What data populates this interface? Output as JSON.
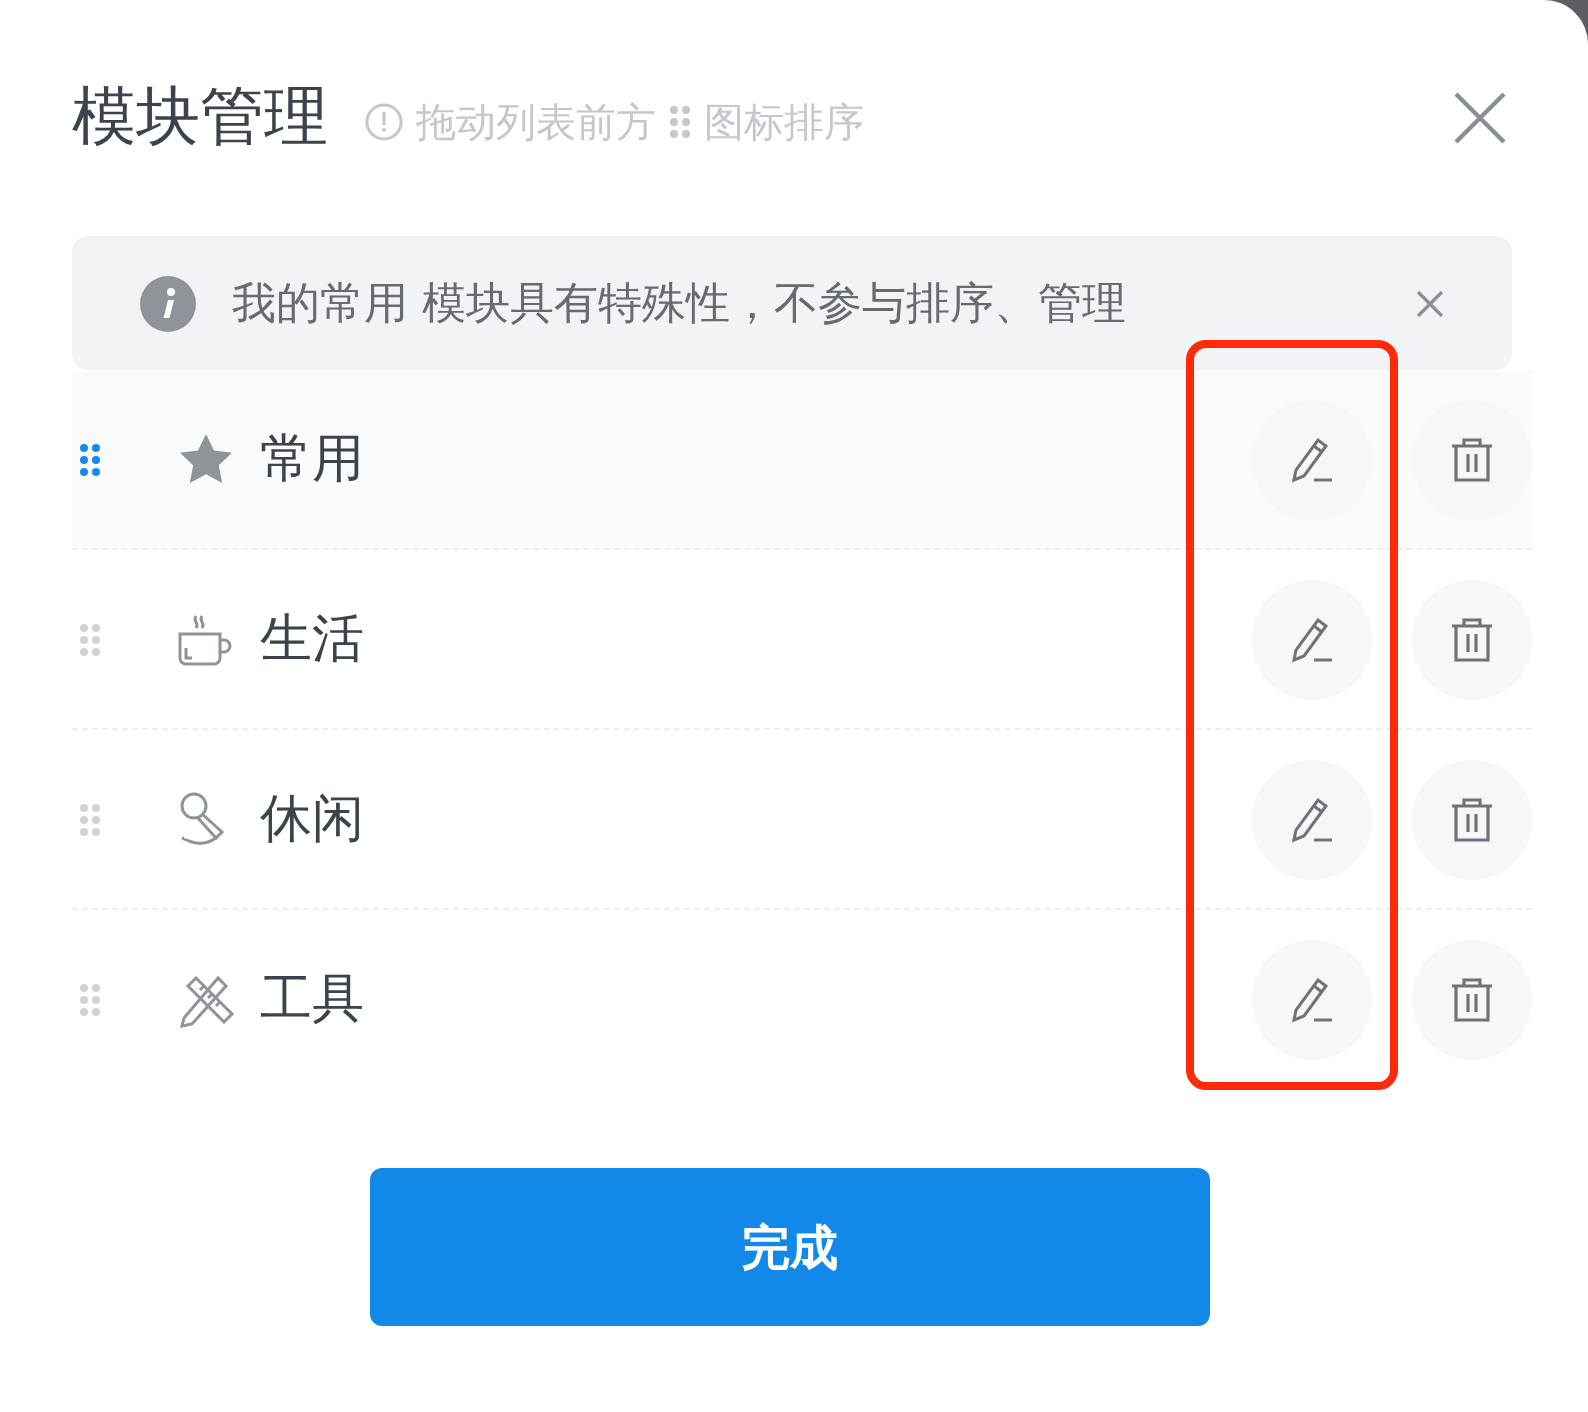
{
  "dialog": {
    "title": "模块管理",
    "hint_before": "拖动列表前方",
    "hint_after": "图标排序"
  },
  "notice": {
    "text": "我的常用 模块具有特殊性，不参与排序、管理"
  },
  "modules": [
    {
      "label": "常用",
      "kind": "star",
      "selected": true
    },
    {
      "label": "生活",
      "kind": "cup",
      "selected": false
    },
    {
      "label": "休闲",
      "kind": "microphone",
      "selected": false
    },
    {
      "label": "工具",
      "kind": "tools",
      "selected": false
    }
  ],
  "confirm_button": "完成"
}
